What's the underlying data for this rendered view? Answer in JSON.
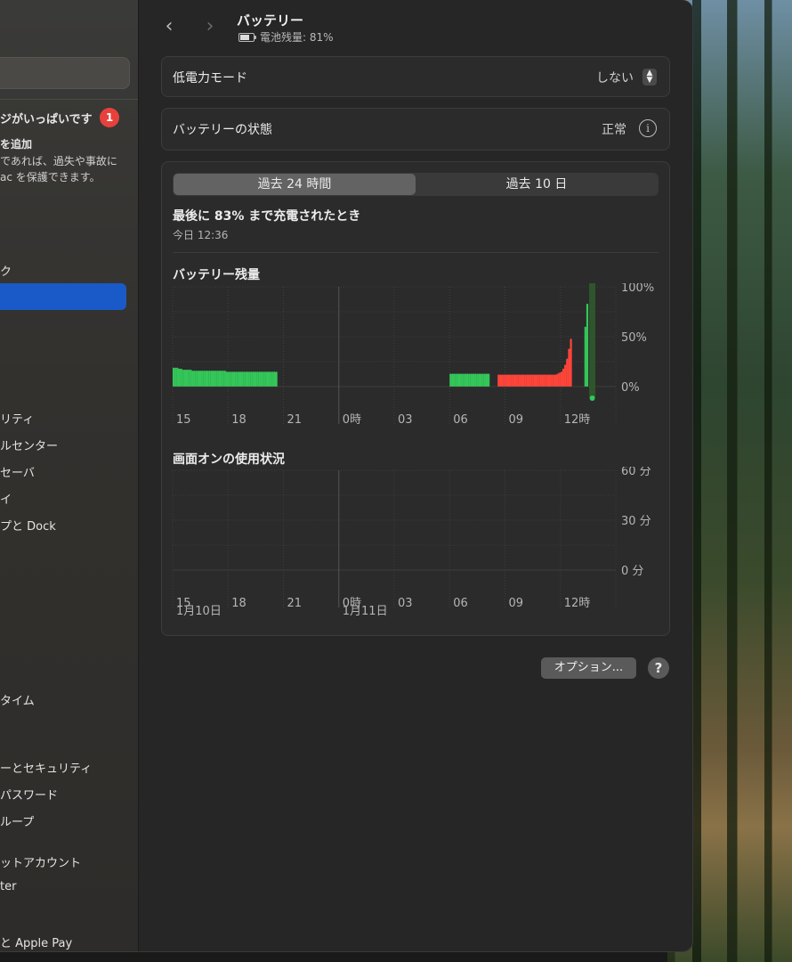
{
  "header": {
    "title": "バッテリー",
    "subtitle": "電池残量: 81%",
    "back_icon": "chevron-left-icon",
    "forward_icon": "chevron-right-icon"
  },
  "sidebar": {
    "notice_title": "ジがいっぱいです",
    "notice_badge": "1",
    "notice_line1": "を追加",
    "notice_line2": "であれば、過失や事故に",
    "notice_line3": "ac を保護できます。",
    "items": [
      {
        "label": "ク"
      },
      {
        "label": ""
      },
      {
        "label": "リティ"
      },
      {
        "label": "ルセンター"
      },
      {
        "label": "セーバ"
      },
      {
        "label": "イ"
      },
      {
        "label": "プと Dock"
      },
      {
        "label": "タイム"
      },
      {
        "label": "ーとセキュリティ"
      },
      {
        "label": "パスワード"
      },
      {
        "label": "ループ"
      },
      {
        "label": "ットアカウント"
      },
      {
        "label": "ter"
      },
      {
        "label": "と Apple Pay"
      }
    ]
  },
  "low_power": {
    "label": "低電力モード",
    "value": "しない"
  },
  "battery_health": {
    "label": "バッテリーの状態",
    "value": "正常",
    "info_icon": "info-icon"
  },
  "tabs": [
    {
      "label": "過去 24 時間",
      "active": true
    },
    {
      "label": "過去 10 日",
      "active": false
    }
  ],
  "last_charge": {
    "text": "最後に 83% まで充電されたとき",
    "time": "今日 12:36"
  },
  "battery_chart_title": "バッテリー残量",
  "screen_chart_title": "画面オンの使用状況",
  "chart_data": [
    {
      "type": "bar",
      "title": "バッテリー残量",
      "y_ticks": [
        "100%",
        "50%",
        "0%"
      ],
      "ylim": [
        0,
        100
      ],
      "x_ticks": [
        "15",
        "18",
        "21",
        "0時",
        "03",
        "06",
        "09",
        "12時"
      ],
      "colors": {
        "normal": "#34c759",
        "low": "#ff453a"
      },
      "segments": [
        {
          "start_hour": 0.0,
          "values": [
            19,
            19,
            19,
            18,
            18,
            17,
            17,
            17,
            17,
            17,
            16,
            16,
            16,
            16,
            16,
            16,
            16,
            16,
            16,
            16,
            16,
            16,
            16,
            16,
            16,
            16,
            16,
            16,
            15,
            15,
            15,
            15,
            15,
            15,
            15,
            15,
            15,
            15,
            15,
            15,
            15,
            15,
            15,
            15,
            15,
            15,
            15,
            15,
            15,
            15,
            15,
            15,
            15,
            15,
            15
          ],
          "status": "normal"
        },
        {
          "start_hour": 15.0,
          "values": [
            13,
            13,
            13,
            13,
            13,
            13,
            13,
            13,
            13,
            13,
            13,
            13,
            13,
            13,
            13,
            13,
            13,
            13,
            13,
            13,
            13
          ],
          "status": "normal"
        },
        {
          "start_hour": 17.6,
          "values": [
            12,
            12,
            12,
            12,
            12,
            12,
            12,
            12,
            12,
            12,
            12,
            12,
            12,
            12,
            12,
            12,
            12,
            12,
            12,
            12,
            12,
            12,
            12,
            12,
            12,
            12,
            12,
            12,
            12,
            12,
            12,
            13,
            14,
            15,
            18,
            22,
            28,
            38,
            48
          ],
          "status": "low"
        },
        {
          "start_hour": 22.3,
          "values": [
            60,
            83
          ],
          "status": "normal"
        }
      ]
    },
    {
      "type": "bar",
      "title": "画面オンの使用状況",
      "y_ticks": [
        "60 分",
        "30 分",
        "0 分"
      ],
      "ylim": [
        0,
        60
      ],
      "x_ticks": [
        "15",
        "18",
        "21",
        "0時",
        "03",
        "06",
        "09",
        "12時"
      ],
      "date_labels": [
        "1月10日",
        "1月11日"
      ],
      "values": []
    }
  ],
  "options_button": "オプション...",
  "help_button": "?"
}
